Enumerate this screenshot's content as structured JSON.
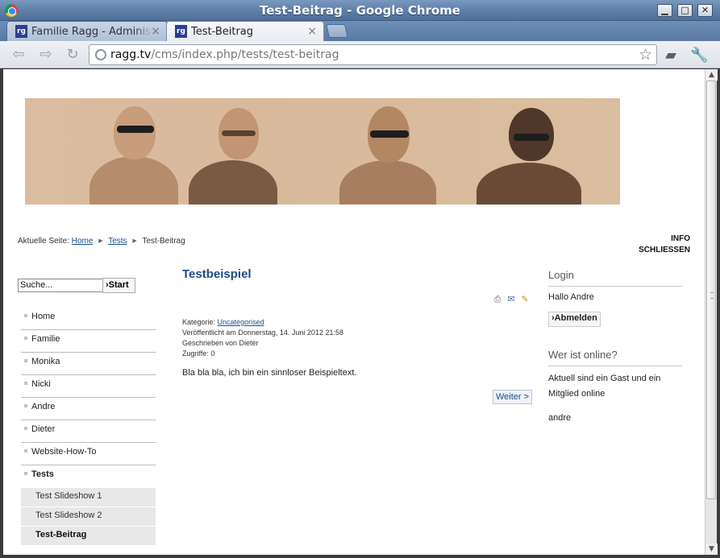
{
  "window": {
    "title": "Test-Beitrag - Google Chrome",
    "controls": {
      "minimize": "▁",
      "maximize": "□",
      "close": "✕"
    }
  },
  "tabs": [
    {
      "label": "Familie Ragg - Administration",
      "favicon": "rg",
      "close": "×"
    },
    {
      "label": "Test-Beitrag",
      "favicon": "rg",
      "close": "×"
    }
  ],
  "toolbar": {
    "url_host": "ragg.tv",
    "url_path": "/cms/index.php/tests/test-beitrag",
    "icons": [
      "back-icon",
      "forward-icon",
      "reload-icon",
      "globe-icon",
      "bookmark-star-icon",
      "book-icon",
      "wrench-icon"
    ]
  },
  "page": {
    "breadcrumb": {
      "prefix": "Aktuelle Seite:",
      "items": [
        "Home",
        "Tests",
        "Test-Beitrag"
      ]
    },
    "top_links": [
      "INFO",
      "SCHLIESSEN"
    ],
    "search": {
      "value": "Suche...",
      "button": "›Start"
    },
    "nav": {
      "items": [
        "Home",
        "Familie",
        "Monika",
        "Nicki",
        "Andre",
        "Dieter",
        "Website-How-To",
        "Tests"
      ],
      "subitems": [
        "Test Slideshow 1",
        "Test Slideshow 2",
        "Test-Beitrag"
      ]
    },
    "article": {
      "title": "Testbeispiel",
      "category_label": "Kategorie:",
      "category": "Uncategorised",
      "published": "Veröffentlicht am Donnerstag, 14. Juni 2012 21:58",
      "author": "Geschrieben von Dieter",
      "hits": "Zugriffe: 0",
      "body": "Bla bla bla, ich bin ein sinnloser Beispieltext.",
      "next": "Weiter >"
    },
    "login": {
      "heading": "Login",
      "greeting": "Hallo Andre",
      "logout": "›Abmelden"
    },
    "online": {
      "heading": "Wer ist online?",
      "text": "Aktuell sind ein Gast und ein Mitglied online",
      "user": "andre"
    }
  }
}
